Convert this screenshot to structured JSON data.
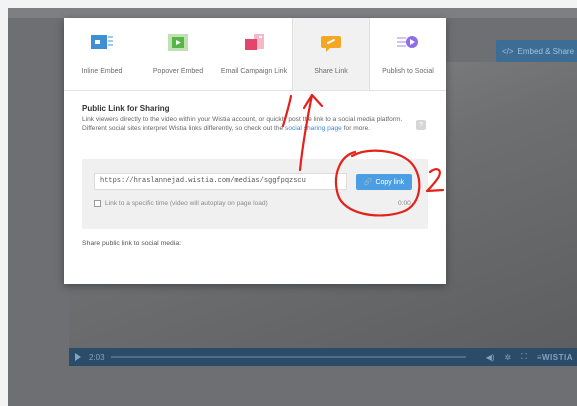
{
  "header": {
    "embed_share_label": "Embed & Share"
  },
  "player": {
    "time": "2:03",
    "brand": "WISTIA"
  },
  "modal": {
    "tabs": [
      {
        "label": "Inline Embed",
        "icon": "inline-embed-icon"
      },
      {
        "label": "Popover Embed",
        "icon": "popover-embed-icon"
      },
      {
        "label": "Email Campaign Link",
        "icon": "email-campaign-icon"
      },
      {
        "label": "Share Link",
        "icon": "share-link-icon",
        "active": true
      },
      {
        "label": "Publish to Social",
        "icon": "publish-social-icon"
      }
    ],
    "public_link": {
      "title": "Public Link for Sharing",
      "desc_a": "Link viewers directly to the video within your Wistia account, or quickly post the link to a social media platform. Different social sites interpret Wistia links differently, so check out the ",
      "desc_link": "social sharing page",
      "desc_b": " for more."
    },
    "url_value": "https://hraslannejad.wistia.com/medias/sggfpqzscu",
    "copy_label": "Copy link",
    "specific_time_label": "Link to a specific time  (video will autoplay on page load)",
    "time_value": "0:00",
    "social_label": "Share public link to social media:"
  },
  "annotations": {
    "arrow_number": "1",
    "circle_number": "2"
  },
  "colors": {
    "accent": "#4b9ee3",
    "annotation": "#e3231b",
    "link": "#3a89d6"
  }
}
